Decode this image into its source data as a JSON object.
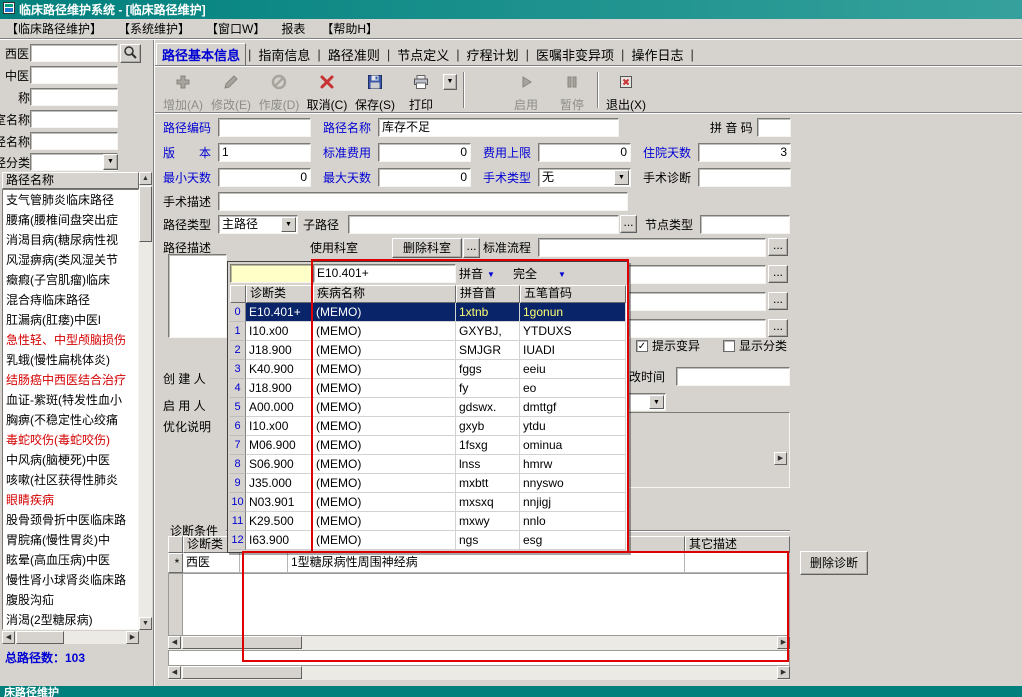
{
  "window": {
    "title": "临床路径维护系统 - [临床路径维护]",
    "statusbar_text": "床路径维护"
  },
  "colors": {
    "titlebar_teal": "#00807d",
    "window_bg": "#d6d3ce",
    "label_blue": "#0000d4",
    "list_red": "#d40000",
    "selection_blue": "#0a246a",
    "cell_yellow": "#ffffc8",
    "annotation_red": "#de0000"
  },
  "glyphs": {
    "up": "▲",
    "down": "▼",
    "left": "◀",
    "right": "▶",
    "combo": "▼",
    "check": "✓",
    "ellipsis": "...",
    "asterisk": "*",
    "pipe": "|"
  },
  "menu": {
    "items": [
      "【临床路径维护】",
      "【系统维护】",
      "【窗口W】",
      "报表",
      "【帮助H】"
    ]
  },
  "left_panel": {
    "filters": [
      {
        "label": "西医",
        "value": ""
      },
      {
        "label": "中医",
        "value": ""
      },
      {
        "label": "称",
        "value": ""
      },
      {
        "label": "室名称",
        "value": ""
      },
      {
        "label": "径名称",
        "value": ""
      },
      {
        "label": "径分类",
        "value": ""
      }
    ],
    "list_header": "路径名称",
    "items": [
      {
        "text": "支气管肺炎临床路径",
        "highlight": false
      },
      {
        "text": "腰痛(腰椎间盘突出症",
        "highlight": false
      },
      {
        "text": "消渴目病(糖尿病性视",
        "highlight": false
      },
      {
        "text": "风湿痹病(类风湿关节",
        "highlight": false
      },
      {
        "text": "癥瘕(子宫肌瘤)临床",
        "highlight": false
      },
      {
        "text": "混合痔临床路径",
        "highlight": false
      },
      {
        "text": "肛漏病(肛瘘)中医l",
        "highlight": false
      },
      {
        "text": "急性轻、中型颅脑损伤",
        "highlight": true
      },
      {
        "text": "乳蛾(慢性扁桃体炎)",
        "highlight": false
      },
      {
        "text": "结肠癌中西医结合治疗",
        "highlight": true
      },
      {
        "text": "血证-紫斑(特发性血小",
        "highlight": false
      },
      {
        "text": "胸痹(不稳定性心绞痛",
        "highlight": false
      },
      {
        "text": "毒蛇咬伤(毒蛇咬伤)",
        "highlight": true
      },
      {
        "text": "中风病(脑梗死)中医",
        "highlight": false
      },
      {
        "text": "咳嗽(社区获得性肺炎",
        "highlight": false
      },
      {
        "text": "眼睛疾病",
        "highlight": true
      },
      {
        "text": "股骨颈骨折中医临床路",
        "highlight": false
      },
      {
        "text": "胃脘痛(慢性胃炎)中",
        "highlight": false
      },
      {
        "text": "眩晕(高血压病)中医",
        "highlight": false
      },
      {
        "text": "慢性肾小球肾炎临床路",
        "highlight": false
      },
      {
        "text": "腹股沟疝",
        "highlight": false
      },
      {
        "text": "消渴(2型糖尿病)",
        "highlight": false
      }
    ],
    "total": "总路径数：103"
  },
  "tabs": {
    "items": [
      {
        "label": "路径基本信息",
        "active": true
      },
      {
        "label": "指南信息",
        "active": false
      },
      {
        "label": "路径准则",
        "active": false
      },
      {
        "label": "节点定义",
        "active": false
      },
      {
        "label": "疗程计划",
        "active": false
      },
      {
        "label": "医嘱非变异项",
        "active": false
      },
      {
        "label": "操作日志",
        "active": false
      }
    ]
  },
  "toolbar": {
    "buttons": [
      {
        "label": "增加(A)",
        "enabled": false
      },
      {
        "label": "修改(E)",
        "enabled": false
      },
      {
        "label": "作废(D)",
        "enabled": false
      },
      {
        "label": "取消(C)",
        "enabled": true
      },
      {
        "label": "保存(S)",
        "enabled": true
      },
      {
        "label": "打印",
        "enabled": true
      },
      {
        "label": "启用",
        "enabled": false
      },
      {
        "label": "暂停",
        "enabled": false
      },
      {
        "label": "退出(X)",
        "enabled": true
      }
    ]
  },
  "form": {
    "path_code_label": "路径编码",
    "path_code": "",
    "path_name_label": "路径名称",
    "path_name": "库存不足",
    "pinyin_label": "拼 音 码",
    "pinyin_code": "",
    "version_label": "版　　本",
    "version": "1",
    "std_fee_label": "标准费用",
    "std_fee": "0",
    "fee_cap_label": "费用上限",
    "fee_cap": "0",
    "hosp_days_label": "住院天数",
    "hosp_days": "3",
    "min_days_label": "最小天数",
    "min_days": "0",
    "max_days_label": "最大天数",
    "max_days": "0",
    "surgery_type_label": "手术类型",
    "surgery_type": "无",
    "surgery_diag_label": "手术诊断",
    "surgery_diag": "",
    "surgery_desc_label": "手术描述",
    "surgery_desc": "",
    "path_type_label": "路径类型",
    "path_type": "主路径",
    "sub_path_label": "子路径",
    "sub_path": "",
    "node_type_label": "节点类型",
    "node_type": "",
    "path_desc_label": "路径描述",
    "use_dept_label": "使用科室",
    "delete_dept_button": "删除科室",
    "std_flow_label": "标准流程",
    "std_flow": "",
    "hint_variation_label": "提示变异",
    "hint_variation_checked": true,
    "show_category_label": "显示分类",
    "show_category_checked": false,
    "modify_time_label": "改时间",
    "modify_time": "",
    "creator_label": "创 建 人",
    "enabler_label": "启 用 人",
    "optimize_label": "优化说明"
  },
  "popup": {
    "code_input": "",
    "search_value": "E10.401+",
    "mode1_label": "拼音",
    "mode2_value": "完全",
    "columns": [
      "诊断类",
      "疾病名称",
      "拼音首",
      "五笔首码"
    ],
    "rows": [
      {
        "n": "0",
        "code": "E10.401+",
        "name": "(MEMO)",
        "py": "1xtnb",
        "wb": "1gonun"
      },
      {
        "n": "1",
        "code": "I10.x00",
        "name": "(MEMO)",
        "py": "GXYBJ,",
        "wb": "YTDUXS"
      },
      {
        "n": "2",
        "code": "J18.900",
        "name": "(MEMO)",
        "py": "SMJGR",
        "wb": "IUADI"
      },
      {
        "n": "3",
        "code": "K40.900",
        "name": "(MEMO)",
        "py": "fggs",
        "wb": "eeiu"
      },
      {
        "n": "4",
        "code": "J18.900",
        "name": "(MEMO)",
        "py": "fy",
        "wb": "eo"
      },
      {
        "n": "5",
        "code": "A00.000",
        "name": "(MEMO)",
        "py": "gdswx.",
        "wb": "dmttgf"
      },
      {
        "n": "6",
        "code": "I10.x00",
        "name": "(MEMO)",
        "py": "gxyb",
        "wb": "ytdu"
      },
      {
        "n": "7",
        "code": "M06.900",
        "name": "(MEMO)",
        "py": "1fsxg",
        "wb": "ominua"
      },
      {
        "n": "8",
        "code": "S06.900",
        "name": "(MEMO)",
        "py": "lnss",
        "wb": "hmrw"
      },
      {
        "n": "9",
        "code": "J35.000",
        "name": "(MEMO)",
        "py": "mxbtt",
        "wb": "nnyswo"
      },
      {
        "n": "10",
        "code": "N03.901",
        "name": "(MEMO)",
        "py": "mxsxq",
        "wb": "nnjigj"
      },
      {
        "n": "11",
        "code": "K29.500",
        "name": "(MEMO)",
        "py": "mxwy",
        "wb": "nnlo"
      },
      {
        "n": "12",
        "code": "I63.900",
        "name": "(MEMO)",
        "py": "ngs",
        "wb": "esg"
      }
    ]
  },
  "diagnosis": {
    "section_title": "诊断条件",
    "col_type": "诊断类",
    "col_other": "其它描述",
    "row_marker": "*",
    "row_type": "西医",
    "row_code": "",
    "row_name": "1型糖尿病性周围神经病",
    "delete_button": "删除诊断"
  }
}
